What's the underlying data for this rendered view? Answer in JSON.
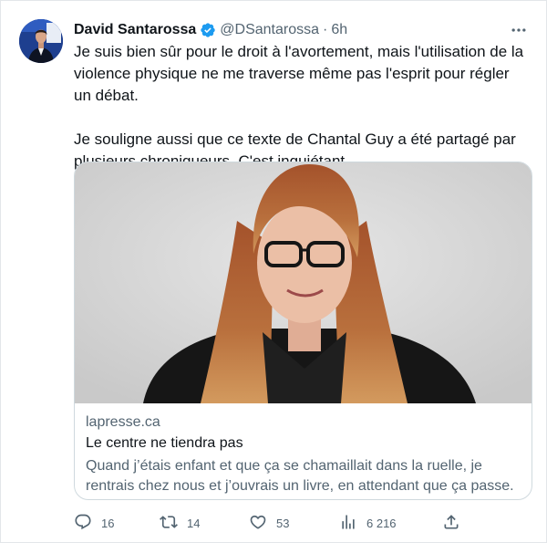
{
  "tweet": {
    "author_name": "David Santarossa",
    "handle": "@DSantarossa",
    "separator": "·",
    "time": "6h",
    "verified": true,
    "paragraphs": [
      "Je suis bien sûr pour le droit à l'avortement, mais l'utilisation de la violence physique ne me traverse même pas l'esprit pour régler un débat.",
      "Je souligne aussi que ce texte de Chantal Guy a été partagé par plusieurs chroniqueurs. C'est inquiétant."
    ]
  },
  "card": {
    "domain": "lapresse.ca",
    "title": "Le centre ne tiendra pas",
    "description": "Quand j’étais enfant et que ça se chamaillait dans la ruelle, je rentrais chez nous et j’ouvrais un livre, en attendant que ça passe. ..."
  },
  "actions": {
    "replies": "16",
    "retweets": "14",
    "likes": "53",
    "views": "6 216"
  },
  "icons": {
    "verified": "verified-badge-icon",
    "more": "more-horizontal-icon",
    "reply": "reply-icon",
    "retweet": "retweet-icon",
    "like": "heart-icon",
    "views": "views-chart-icon",
    "share": "share-icon"
  },
  "colors": {
    "text": "#0f1419",
    "secondary": "#536471",
    "verified": "#1d9bf0",
    "border": "#cfd9de"
  }
}
